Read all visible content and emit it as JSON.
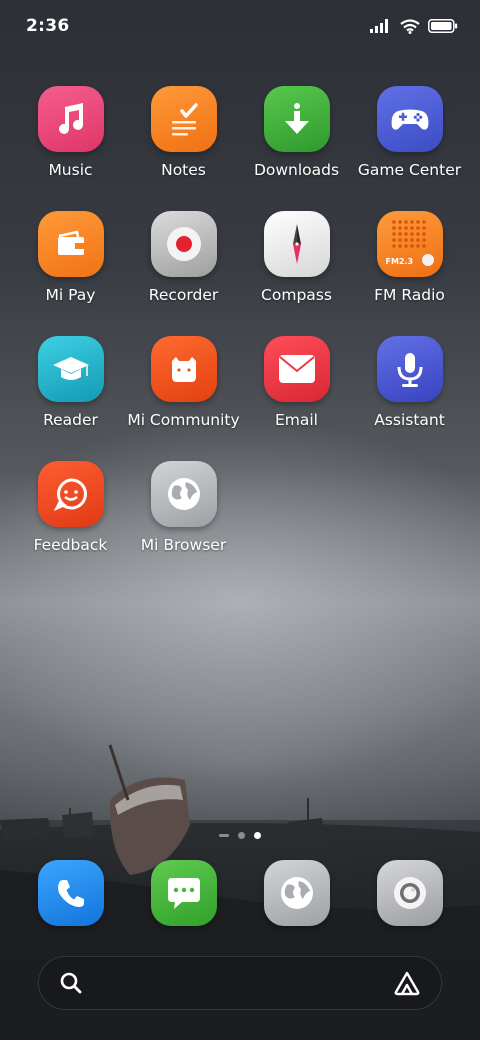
{
  "status_bar": {
    "time": "2:36"
  },
  "apps": [
    {
      "label": "Music"
    },
    {
      "label": "Notes"
    },
    {
      "label": "Downloads"
    },
    {
      "label": "Game Center"
    },
    {
      "label": "Mi Pay"
    },
    {
      "label": "Recorder"
    },
    {
      "label": "Compass"
    },
    {
      "label": "FM Radio",
      "badge_text": "FM2.3"
    },
    {
      "label": "Reader"
    },
    {
      "label": "Mi Community"
    },
    {
      "label": "Email"
    },
    {
      "label": "Assistant"
    },
    {
      "label": "Feedback"
    },
    {
      "label": "Mi Browser"
    }
  ],
  "dock": [
    {
      "name": "Phone"
    },
    {
      "name": "Messages"
    },
    {
      "name": "Browser"
    },
    {
      "name": "Camera"
    }
  ],
  "page_indicator": {
    "total_dots": 2,
    "active_index": 1
  },
  "colors": {
    "music": "#e8457a",
    "notes": "#f57b1e",
    "downloads": "#3fae3a",
    "game_center": "#4b5fd6",
    "mi_pay": "#f5821f",
    "recorder": "#c9c9c9",
    "compass": "#f2f2f2",
    "fm_radio": "#f27a1a",
    "reader": "#1bb0c9",
    "mi_community": "#f0531f",
    "email": "#ec3a45",
    "assistant": "#4a55d0",
    "feedback": "#ee4b22",
    "mi_browser": "#b9bcc0",
    "phone": "#1f8cf0",
    "messages": "#46b53a"
  }
}
